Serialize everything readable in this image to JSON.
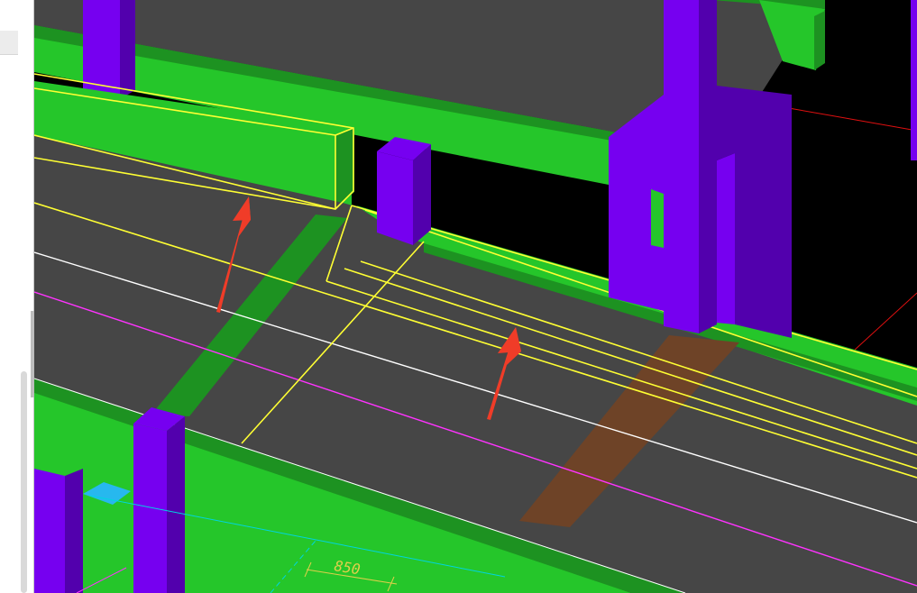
{
  "viewport": {
    "dimension_label": "850"
  },
  "colors": {
    "background": "#000000",
    "slab": "#464646",
    "beam": "#25c62a",
    "beam_dark": "#1d9221",
    "column": "#7600f0",
    "column_dark": "#5200ad",
    "selection": "#ffff33",
    "arrow": "#f03c28",
    "grid_magenta": "#ff33ff",
    "grid_white": "#ffffff",
    "grid_red": "#e01010",
    "highlight_strip": "#6e4327",
    "dimension": "#e0d04a",
    "cyan_line": "#00d5e0",
    "cyan_block": "#27b8ee",
    "panel_bg": "#ffffff"
  },
  "markers": [
    {
      "name": "arrow-marker-upper",
      "icon": "up-arrow-icon"
    },
    {
      "name": "arrow-marker-lower",
      "icon": "up-arrow-icon"
    }
  ]
}
